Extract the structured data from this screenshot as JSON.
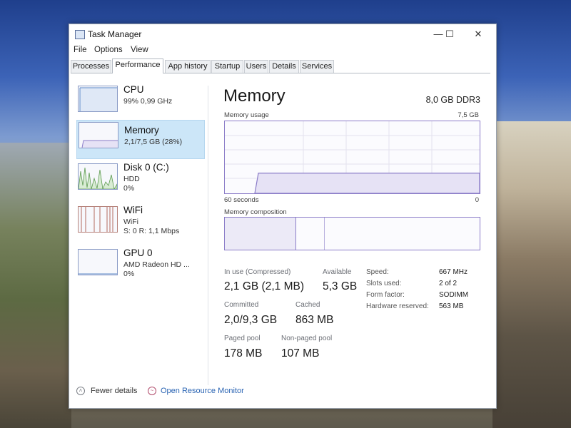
{
  "window": {
    "title": "Task Manager",
    "min": "—",
    "max": "☐",
    "close": "✕"
  },
  "menu": [
    "File",
    "Options",
    "View"
  ],
  "tabs": [
    "Processes",
    "Performance",
    "App history",
    "Startup",
    "Users",
    "Details",
    "Services"
  ],
  "active_tab": "Performance",
  "sidebar": [
    {
      "title": "CPU",
      "sub1": "99% 0,99 GHz",
      "sub2": "",
      "sub3": ""
    },
    {
      "title": "Memory",
      "sub1": "2,1/7,5 GB (28%)",
      "sub2": "",
      "sub3": ""
    },
    {
      "title": "Disk 0 (C:)",
      "sub1": "HDD",
      "sub2": "0%",
      "sub3": ""
    },
    {
      "title": "WiFi",
      "sub1": "WiFi",
      "sub2": "S: 0 R: 1,1 Mbps",
      "sub3": ""
    },
    {
      "title": "GPU 0",
      "sub1": "AMD Radeon HD ...",
      "sub2": "0%",
      "sub3": ""
    }
  ],
  "selected_item": "Memory",
  "main": {
    "title": "Memory",
    "spec": "8,0 GB DDR3",
    "usage_label": "Memory usage",
    "usage_max": "7,5 GB",
    "time_left": "60 seconds",
    "time_right": "0",
    "composition_label": "Memory composition"
  },
  "stats": {
    "in_use_label": "In use (Compressed)",
    "in_use_value": "2,1 GB (2,1 MB)",
    "available_label": "Available",
    "available_value": "5,3 GB",
    "committed_label": "Committed",
    "committed_value": "2,0/9,3 GB",
    "cached_label": "Cached",
    "cached_value": "863 MB",
    "paged_label": "Paged pool",
    "paged_value": "178 MB",
    "nonpaged_label": "Non-paged pool",
    "nonpaged_value": "107 MB"
  },
  "details": [
    {
      "label": "Speed:",
      "value": "667 MHz"
    },
    {
      "label": "Slots used:",
      "value": "2 of 2"
    },
    {
      "label": "Form factor:",
      "value": "SODIMM"
    },
    {
      "label": "Hardware reserved:",
      "value": "563 MB"
    }
  ],
  "footer": {
    "fewer": "Fewer details",
    "open_monitor": "Open Resource Monitor"
  },
  "memory_usage_fraction": 0.28,
  "colors": {
    "accent": "#8b7cc8",
    "selected": "#cce6f8",
    "link": "#2a64b3"
  }
}
